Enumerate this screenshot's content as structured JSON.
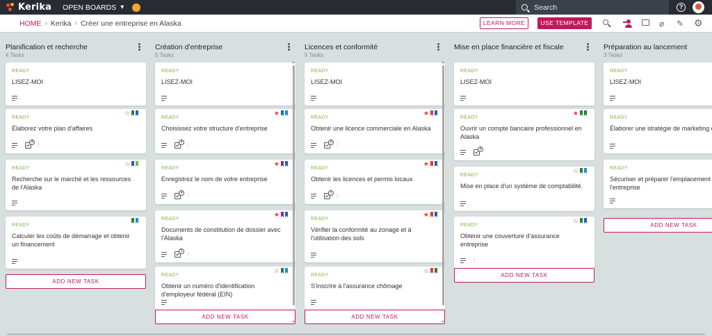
{
  "topbar": {
    "logo_text": "Kerika",
    "open_boards_label": "OPEN BOARDS",
    "search_placeholder": "Search"
  },
  "breadcrumb": {
    "home": "HOME",
    "org": "Kerika",
    "board": "Créer une entreprise en Alaska"
  },
  "actions": {
    "learn_more": "LEARN MORE",
    "use_template": "USE TEMPLATE"
  },
  "colors": {
    "accent": "#c2185b",
    "ready": "#7cb342",
    "topbar": "#272c34",
    "board_bg": "#d8dfdf"
  },
  "columns": [
    {
      "title": "Planification et recherche",
      "count": "4 Tasks",
      "add_label": "ADD NEW TASK",
      "cards": [
        {
          "status": "READY",
          "title": "LISEZ-MOI",
          "star": "",
          "flags": [],
          "checklist": "",
          "attachment": false
        },
        {
          "status": "READY",
          "title": "Élaborez votre plan d'affaires",
          "star": "empty",
          "flags": [
            "#2e7d32",
            "#1565c0"
          ],
          "checklist": "4",
          "attachment": true
        },
        {
          "status": "READY",
          "title": "Recherche sur le marché et les ressources de l'Alaska",
          "star": "empty",
          "flags": [
            "#1565c0",
            "#7cb342"
          ],
          "checklist": "",
          "attachment": false
        },
        {
          "status": "READY",
          "title": "Calculer les coûts de démarrage et obtenir un financement",
          "star": "",
          "flags": [
            "#2e7d32",
            "#1e88e5"
          ],
          "checklist": "",
          "attachment": false
        }
      ]
    },
    {
      "title": "Création d'entreprise",
      "count": "5 Tasks",
      "add_label": "ADD NEW TASK",
      "cards": [
        {
          "status": "READY",
          "title": "LISEZ-MOI",
          "star": "",
          "flags": [],
          "checklist": "",
          "attachment": false
        },
        {
          "status": "READY",
          "title": "Choisissez votre structure d'entreprise",
          "star": "full",
          "flags": [
            "#1565c0",
            "#1e88e5"
          ],
          "checklist": "4",
          "attachment": true
        },
        {
          "status": "READY",
          "title": "Enregistrez le nom de votre entreprise",
          "star": "full",
          "flags": [
            "#8e24aa",
            "#1565c0"
          ],
          "checklist": "4",
          "attachment": true
        },
        {
          "status": "READY",
          "title": "Documents de constitution de dossier avec l'Alaska",
          "star": "full",
          "flags": [
            "#8e24aa",
            "#1565c0"
          ],
          "checklist": "1",
          "attachment": true
        },
        {
          "status": "READY",
          "title": "Obtenir un numéro d'identification d'employeur fédéral (EIN)",
          "star": "empty",
          "flags": [
            "#2e7d32",
            "#1e88e5"
          ],
          "checklist": "",
          "attachment": false
        }
      ]
    },
    {
      "title": "Licences et conformité",
      "count": "5 Tasks",
      "add_label": "ADD NEW TASK",
      "cards": [
        {
          "status": "READY",
          "title": "LISEZ-MOI",
          "star": "",
          "flags": [],
          "checklist": "",
          "attachment": false
        },
        {
          "status": "READY",
          "title": "Obtenir une licence commerciale en Alaska",
          "star": "full",
          "flags": [
            "#e53935",
            "#1565c0"
          ],
          "checklist": "4",
          "attachment": true
        },
        {
          "status": "READY",
          "title": "Obtenir les licences et permis locaux",
          "star": "full",
          "flags": [
            "#e53935",
            "#1565c0"
          ],
          "checklist": "1",
          "attachment": true
        },
        {
          "status": "READY",
          "title": "Vérifier la conformité au zonage et à l'utilisation des sols",
          "star": "full",
          "flags": [
            "#e53935",
            "#1565c0"
          ],
          "checklist": "",
          "attachment": false
        },
        {
          "status": "READY",
          "title": "S'inscrire à l'assurance chômage",
          "star": "empty",
          "flags": [
            "#e53935",
            "#2e7d32"
          ],
          "checklist": "",
          "attachment": false
        }
      ]
    },
    {
      "title": "Mise en place financière et fiscale",
      "count": "",
      "add_label": "ADD NEW TASK",
      "cards": [
        {
          "status": "READY",
          "title": "LISEZ-MOI",
          "star": "",
          "flags": [],
          "checklist": "",
          "attachment": false
        },
        {
          "status": "READY",
          "title": "Ouvrir un compte bancaire professionnel en Alaska",
          "star": "full",
          "flags": [
            "#2e7d32",
            "#2e7d32"
          ],
          "checklist": "4",
          "attachment": false
        },
        {
          "status": "READY",
          "title": "Mise en place d'un système de comptabilité.",
          "star": "empty",
          "flags": [
            "#2e7d32",
            "#1e88e5"
          ],
          "checklist": "",
          "attachment": false
        },
        {
          "status": "READY",
          "title": "Obtenir une couverture d'assurance entreprise",
          "star": "empty",
          "flags": [
            "#2e7d32",
            "#1565c0"
          ],
          "checklist": "",
          "attachment": true
        }
      ]
    },
    {
      "title": "Préparation au lancement",
      "count": "3 Tasks",
      "add_label": "ADD NEW TASK",
      "cards": [
        {
          "status": "READY",
          "title": "LISEZ-MOI",
          "star": "",
          "flags": [],
          "checklist": "",
          "attachment": false
        },
        {
          "status": "READY",
          "title": "Élaborer une stratégie de marketing et de",
          "star": "",
          "flags": [],
          "checklist": "",
          "attachment": false
        },
        {
          "status": "READY",
          "title": "Sécuriser et préparer l'emplacement de l'entreprise",
          "star": "",
          "flags": [],
          "checklist": "",
          "attachment": false
        }
      ]
    }
  ]
}
